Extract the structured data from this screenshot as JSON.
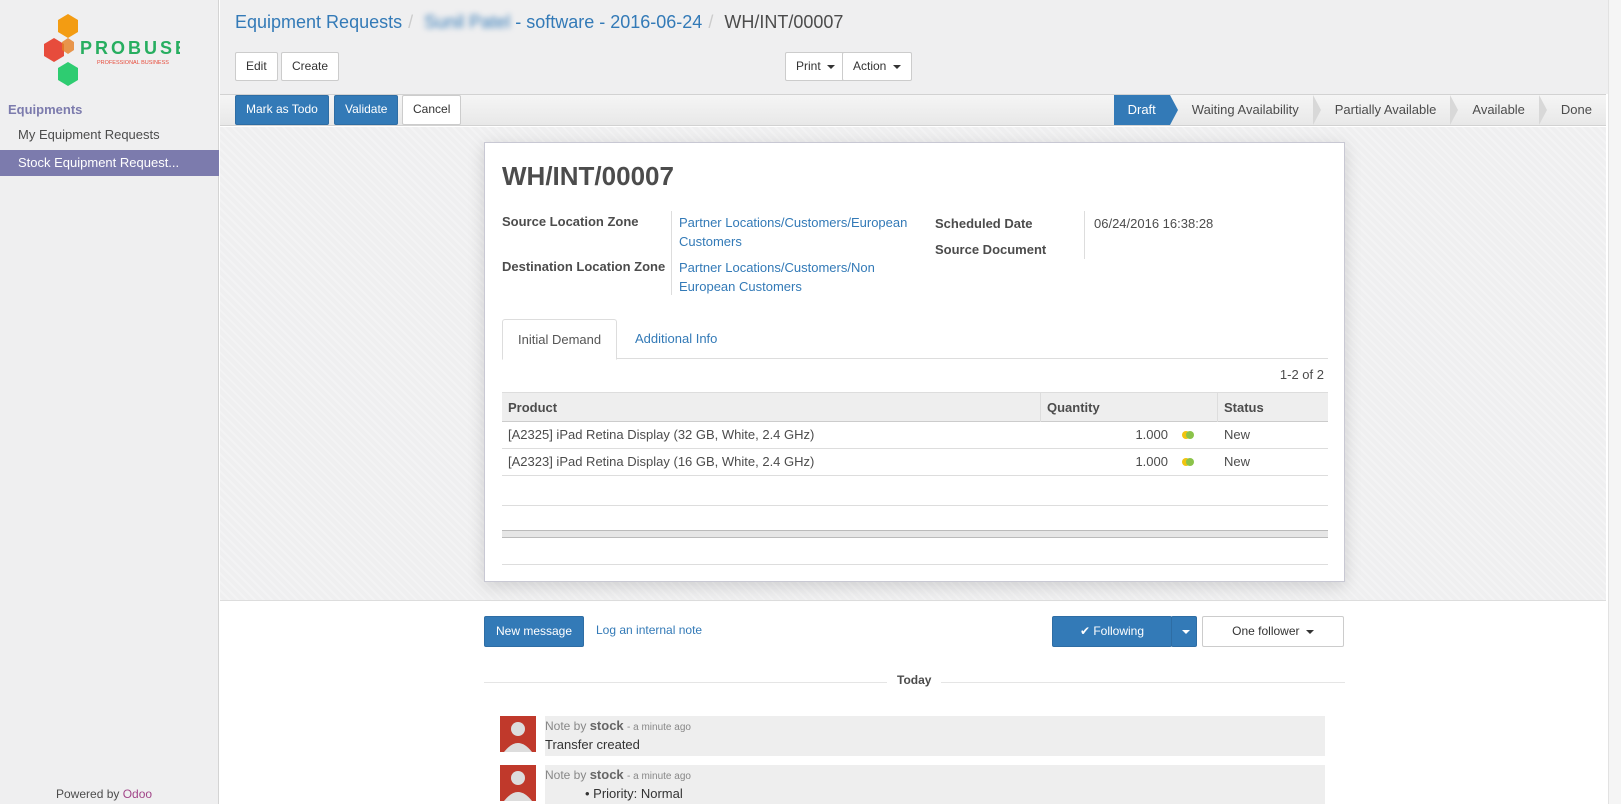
{
  "sidebar": {
    "logo_text": "PROBUSE",
    "logo_tagline": "PROFESSIONAL BUSINESS",
    "section": "Equipments",
    "items": [
      {
        "label": "My Equipment Requests"
      },
      {
        "label": "Stock Equipment Request..."
      }
    ],
    "powered_by": "Powered by",
    "powered_brand": "Odoo"
  },
  "breadcrumb": {
    "root": "Equipment Requests",
    "middle_blurred": "Sunil Patel",
    "middle_rest": "- software - 2016-06-24",
    "current": "WH/INT/00007"
  },
  "toolbar": {
    "edit": "Edit",
    "create": "Create",
    "print": "Print",
    "action": "Action"
  },
  "statusbar": {
    "buttons": {
      "todo": "Mark as Todo",
      "validate": "Validate",
      "cancel": "Cancel"
    },
    "stages": [
      "Draft",
      "Waiting Availability",
      "Partially Available",
      "Available",
      "Done"
    ],
    "active_stage": "Draft"
  },
  "form": {
    "title": "WH/INT/00007",
    "source_zone_label": "Source Location Zone",
    "source_zone_line1": "Partner Locations/Customers/European",
    "source_zone_line2": "Customers",
    "dest_zone_label": "Destination Location Zone",
    "dest_zone_line1": "Partner Locations/Customers/Non",
    "dest_zone_line2": "European Customers",
    "scheduled_label": "Scheduled Date",
    "scheduled_value": "06/24/2016 16:38:28",
    "source_doc_label": "Source Document",
    "tabs": [
      "Initial Demand",
      "Additional Info"
    ],
    "pager": "1-2 of 2",
    "columns": {
      "product": "Product",
      "quantity": "Quantity",
      "status": "Status"
    },
    "rows": [
      {
        "product": "[A2325] iPad Retina Display (32 GB, White, 2.4 GHz)",
        "quantity": "1.000",
        "status": "New"
      },
      {
        "product": "[A2323] iPad Retina Display (16 GB, White, 2.4 GHz)",
        "quantity": "1.000",
        "status": "New"
      }
    ]
  },
  "chatter": {
    "new_message": "New message",
    "log_note": "Log an internal note",
    "following": "Following",
    "followers": "One follower",
    "day": "Today",
    "messages": [
      {
        "prefix": "Note by",
        "author": "stock",
        "time": "- a minute ago",
        "body": "Transfer created"
      },
      {
        "prefix": "Note by",
        "author": "stock",
        "time": "- a minute ago",
        "body": "Priority: Normal"
      }
    ]
  },
  "colors": {
    "primary": "#337ab7",
    "sidebar_active": "#7c7bad",
    "brand": "#a24689"
  }
}
